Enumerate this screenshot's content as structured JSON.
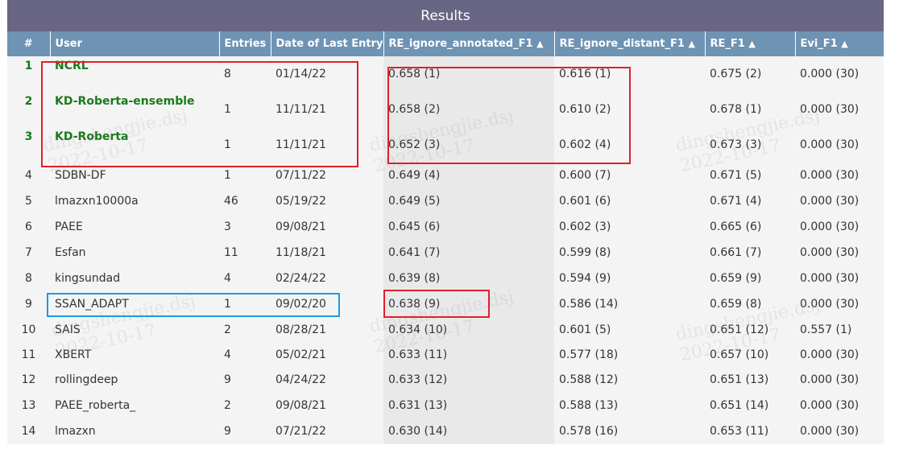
{
  "title": "Results",
  "columns": [
    "#",
    "User",
    "Entries",
    "Date of Last Entry",
    "RE_ignore_annotated_F1",
    "RE_ignore_distant_F1",
    "RE_F1",
    "Evi_F1"
  ],
  "sort_arrow": "▲",
  "rows": [
    {
      "rank": "1",
      "user": "NCRL",
      "entries": "8",
      "date": "01/14/22",
      "re_ig_ann": "0.658 (1)",
      "re_ig_dist": "0.616 (1)",
      "re_f1": "0.675 (2)",
      "evi_f1": "0.000 (30)"
    },
    {
      "rank": "2",
      "user": "KD-Roberta-ensemble",
      "entries": "1",
      "date": "11/11/21",
      "re_ig_ann": "0.658 (2)",
      "re_ig_dist": "0.610 (2)",
      "re_f1": "0.678 (1)",
      "evi_f1": "0.000 (30)"
    },
    {
      "rank": "3",
      "user": "KD-Roberta",
      "entries": "1",
      "date": "11/11/21",
      "re_ig_ann": "0.652 (3)",
      "re_ig_dist": "0.602 (4)",
      "re_f1": "0.673 (3)",
      "evi_f1": "0.000 (30)"
    },
    {
      "rank": "4",
      "user": "SDBN-DF",
      "entries": "1",
      "date": "07/11/22",
      "re_ig_ann": "0.649 (4)",
      "re_ig_dist": "0.600 (7)",
      "re_f1": "0.671 (5)",
      "evi_f1": "0.000 (30)"
    },
    {
      "rank": "5",
      "user": "lmazxn10000a",
      "entries": "46",
      "date": "05/19/22",
      "re_ig_ann": "0.649 (5)",
      "re_ig_dist": "0.601 (6)",
      "re_f1": "0.671 (4)",
      "evi_f1": "0.000 (30)"
    },
    {
      "rank": "6",
      "user": "PAEE",
      "entries": "3",
      "date": "09/08/21",
      "re_ig_ann": "0.645 (6)",
      "re_ig_dist": "0.602 (3)",
      "re_f1": "0.665 (6)",
      "evi_f1": "0.000 (30)"
    },
    {
      "rank": "7",
      "user": "Esfan",
      "entries": "11",
      "date": "11/18/21",
      "re_ig_ann": "0.641 (7)",
      "re_ig_dist": "0.599 (8)",
      "re_f1": "0.661 (7)",
      "evi_f1": "0.000 (30)"
    },
    {
      "rank": "8",
      "user": "kingsundad",
      "entries": "4",
      "date": "02/24/22",
      "re_ig_ann": "0.639 (8)",
      "re_ig_dist": "0.594 (9)",
      "re_f1": "0.659 (9)",
      "evi_f1": "0.000 (30)"
    },
    {
      "rank": "9",
      "user": "SSAN_ADAPT",
      "entries": "1",
      "date": "09/02/20",
      "re_ig_ann": "0.638 (9)",
      "re_ig_dist": "0.586 (14)",
      "re_f1": "0.659 (8)",
      "evi_f1": "0.000 (30)"
    },
    {
      "rank": "10",
      "user": "SAIS",
      "entries": "2",
      "date": "08/28/21",
      "re_ig_ann": "0.634 (10)",
      "re_ig_dist": "0.601 (5)",
      "re_f1": "0.651 (12)",
      "evi_f1": "0.557 (1)"
    },
    {
      "rank": "11",
      "user": "XBERT",
      "entries": "4",
      "date": "05/02/21",
      "re_ig_ann": "0.633 (11)",
      "re_ig_dist": "0.577 (18)",
      "re_f1": "0.657 (10)",
      "evi_f1": "0.000 (30)"
    },
    {
      "rank": "12",
      "user": "rollingdeep",
      "entries": "9",
      "date": "04/24/22",
      "re_ig_ann": "0.633 (12)",
      "re_ig_dist": "0.588 (12)",
      "re_f1": "0.651 (13)",
      "evi_f1": "0.000 (30)"
    },
    {
      "rank": "13",
      "user": "PAEE_roberta_",
      "entries": "2",
      "date": "09/08/21",
      "re_ig_ann": "0.631 (13)",
      "re_ig_dist": "0.588 (13)",
      "re_f1": "0.651 (14)",
      "evi_f1": "0.000 (30)"
    },
    {
      "rank": "14",
      "user": "lmazxn",
      "entries": "9",
      "date": "07/21/22",
      "re_ig_ann": "0.630 (14)",
      "re_ig_dist": "0.578 (16)",
      "re_f1": "0.653 (11)",
      "evi_f1": "0.000 (30)"
    }
  ],
  "watermark": {
    "line1": "dingshengjie.dsj",
    "line2": "2022-10-17"
  },
  "colors": {
    "title_bg": "#686684",
    "header_bg": "#6f93b3",
    "top_rank_text": "#1a7a1a",
    "highlight_red": "#e0202a",
    "highlight_blue": "#1a9be0"
  }
}
